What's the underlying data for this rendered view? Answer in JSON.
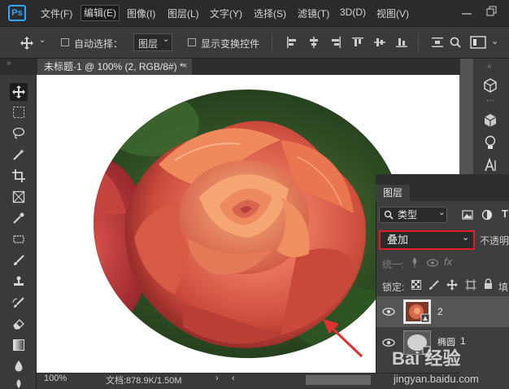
{
  "app": {
    "logo": "Ps"
  },
  "menubar": {
    "items": [
      {
        "label": "文件(F)",
        "active": false
      },
      {
        "label": "编辑(E)",
        "active": true
      },
      {
        "label": "图像(I)",
        "active": false
      },
      {
        "label": "图层(L)",
        "active": false
      },
      {
        "label": "文字(Y)",
        "active": false
      },
      {
        "label": "选择(S)",
        "active": false
      },
      {
        "label": "滤镜(T)",
        "active": false
      },
      {
        "label": "3D(D)",
        "active": false
      },
      {
        "label": "视图(V)",
        "active": false
      }
    ]
  },
  "options_bar": {
    "auto_select_label": "自动选择：",
    "auto_select_target": "图层",
    "show_transform_label": "显示变换控件"
  },
  "document": {
    "tab_title": "未标题-1 @ 100% (2, RGB/8#) *",
    "close_glyph": "×"
  },
  "layers_panel": {
    "title": "图层",
    "filter_label": "类型",
    "blend_mode": "叠加",
    "opacity_label": "不透明",
    "unify_label": "统一:",
    "lock_label": "锁定:",
    "fill_label": "填",
    "layers": [
      {
        "name": "2",
        "visible": true,
        "selected": true
      },
      {
        "name": "1",
        "visible": true,
        "selected": false,
        "thumb_label": "椭圆"
      }
    ]
  },
  "status_bar": {
    "zoom": "100%",
    "doc_size": "文档:878.9K/1.50M"
  },
  "watermark": {
    "text": "Bai 经验",
    "url": "jingyan.baidu.com"
  },
  "colors": {
    "highlight": "#e02020",
    "ps_blue": "#31a8ff",
    "arrow": "#e03030"
  }
}
